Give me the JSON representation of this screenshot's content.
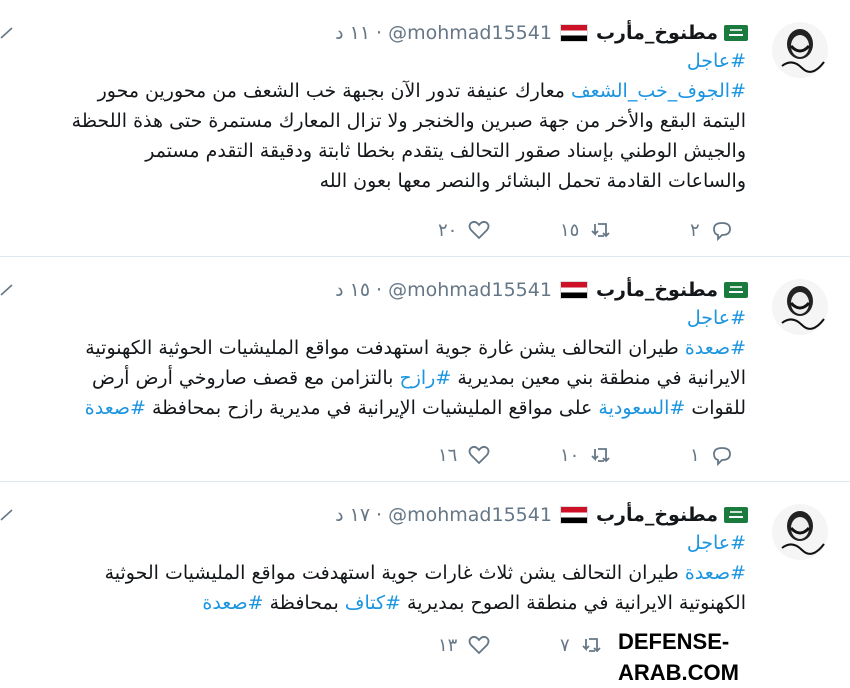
{
  "tweets": [
    {
      "name": "مطنوخ_مأرب",
      "handle": "@mohmad15541",
      "time": "١١ د",
      "lines": [
        [
          {
            "t": "#عاجل",
            "tag": true
          }
        ],
        [
          {
            "t": "#الجوف_خب_الشعف",
            "tag": true
          },
          {
            "t": " معارك عنيفة تدور الآن  بجبهة خب الشعف من محورين محور",
            "tag": false
          }
        ],
        [
          {
            "t": "اليتمة البقع والأخر من جهة صبرين والخنجر ولا تزال المعارك مستمرة حتى هذة اللحظة",
            "tag": false
          }
        ],
        [
          {
            "t": "والجيش الوطني بإسناد صقور التحالف يتقدم بخطا ثابتة ودقيقة التقدم مستمر",
            "tag": false
          }
        ],
        [
          {
            "t": "والساعات القادمة تحمل البشائر والنصر معها بعون الله",
            "tag": false
          }
        ]
      ],
      "replies": "٢",
      "retweets": "١٥",
      "likes": "٢٠"
    },
    {
      "name": "مطنوخ_مأرب",
      "handle": "@mohmad15541",
      "time": "١٥ د",
      "lines": [
        [
          {
            "t": "#عاجل",
            "tag": true
          }
        ],
        [
          {
            "t": "#صعدة",
            "tag": true
          },
          {
            "t": " طيران التحالف يشن غارة جوية استهدفت مواقع المليشيات الحوثية الكهنوتية",
            "tag": false
          }
        ],
        [
          {
            "t": "الايرانية في منطقة بني معين بمديرية ",
            "tag": false
          },
          {
            "t": "#رازح",
            "tag": true
          },
          {
            "t": " بالتزامن مع قصف صاروخي أرض أرض",
            "tag": false
          }
        ],
        [
          {
            "t": "للقوات ",
            "tag": false
          },
          {
            "t": "#السعودية",
            "tag": true
          },
          {
            "t": " على مواقع المليشيات الإيرانية في مديرية رازح بمحافظة ",
            "tag": false
          },
          {
            "t": "#صعدة",
            "tag": true
          }
        ]
      ],
      "replies": "١",
      "retweets": "١٠",
      "likes": "١٦"
    },
    {
      "name": "مطنوخ_مأرب",
      "handle": "@mohmad15541",
      "time": "١٧ د",
      "lines": [
        [
          {
            "t": "#عاجل",
            "tag": true
          }
        ],
        [
          {
            "t": "#صعدة",
            "tag": true
          },
          {
            "t": " طيران التحالف يشن ثلاث غارات جوية استهدفت مواقع المليشيات الحوثية",
            "tag": false
          }
        ],
        [
          {
            "t": "الكهنوتية الايرانية في منطقة الصوح بمديرية ",
            "tag": false
          },
          {
            "t": "#كتاف",
            "tag": true
          },
          {
            "t": " بمحافظة ",
            "tag": false
          },
          {
            "t": "#صعدة",
            "tag": true
          }
        ]
      ],
      "replies": "",
      "retweets": "٧",
      "likes": "١٣"
    }
  ],
  "watermark": "DEFENSE-ARAB.COM",
  "colors": {
    "link": "#1b95e0",
    "muted": "#657786",
    "divider": "#e1e8ed"
  },
  "icons": [
    "caret-down-icon",
    "saudi-flag-icon",
    "yemen-flag-icon",
    "reply-icon",
    "retweet-icon",
    "like-icon"
  ]
}
